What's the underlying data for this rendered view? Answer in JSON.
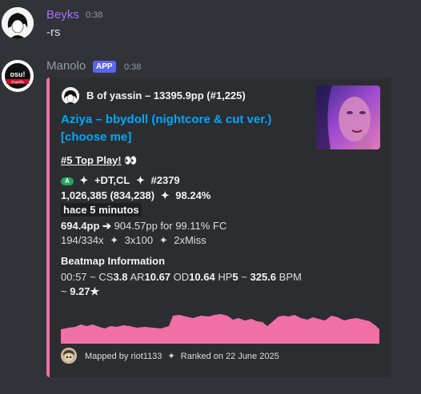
{
  "messages": [
    {
      "author": "Beyks",
      "time": "0:38",
      "content": "-rs",
      "name_color": "#a970ff"
    },
    {
      "author": "Manolo",
      "badge": "APP",
      "time": "0:38",
      "avatar_text": "osu! España",
      "embed": {
        "accent_color": "#f06fa4",
        "author": "B of yassin – 13395.9pp (#1,225)",
        "title_line1": "Aziya – bbydoll (nightcore & cut ver.)",
        "title_line2": "[choose me]",
        "top_play": "#5 Top Play!",
        "top_play_emoji": "👀",
        "mod_badge": "A",
        "mods": "+DT,CL",
        "rank": "#2379",
        "score": "1,026,385 (834,238)",
        "accuracy": "98.24%",
        "ago": "hace 5 minutos",
        "pp": "694.4pp",
        "arrow": "➔",
        "fc_text": "904.57pp for 99.11% FC",
        "combo": "194/334x",
        "hits100": "3x100",
        "misses": "2xMiss",
        "separator": "✦",
        "beatmap_header": "Beatmap Information",
        "bm_length": "00:57",
        "bm_cs_label": "CS",
        "bm_cs": "3.8",
        "bm_ar_label": "AR",
        "bm_ar": "10.67",
        "bm_od_label": "OD",
        "bm_od": "10.64",
        "bm_hp_label": "HP",
        "bm_hp": "5",
        "bm_bpm": "325.6",
        "bm_bpm_label": "BPM",
        "bm_sep": "~",
        "stars": "9.27★",
        "footer_mapped": "Mapped by riot1133",
        "footer_ranked": "Ranked on 22 June 2025",
        "graph_color": "#f06fa4"
      }
    }
  ]
}
